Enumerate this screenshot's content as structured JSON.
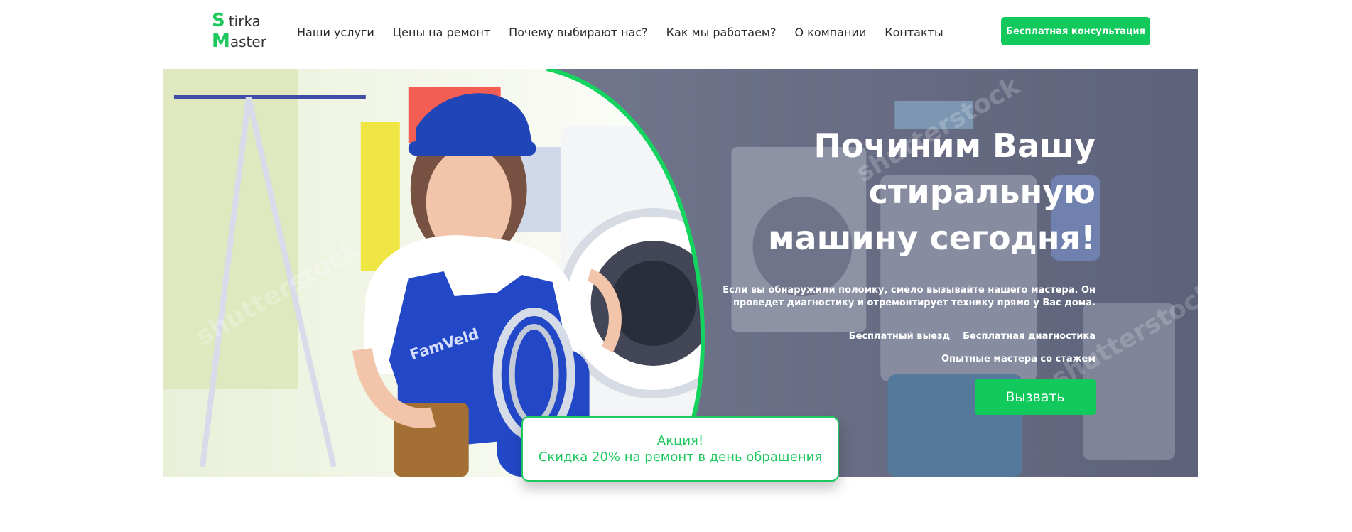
{
  "brand": {
    "logo_s": "S",
    "logo_tirka": "tirka",
    "logo_m": "M",
    "logo_aster": "aster",
    "accent_color": "#12c95c"
  },
  "nav": {
    "items": [
      {
        "label": "Наши услуги"
      },
      {
        "label": "Цены на ремонт"
      },
      {
        "label": "Почему выбирают нас?"
      },
      {
        "label": "Как мы работаем?"
      },
      {
        "label": "О компании"
      },
      {
        "label": "Контакты"
      }
    ],
    "cta_label": "Бесплатная консультация"
  },
  "hero": {
    "title_line1": "Починим Вашу",
    "title_line2": "стиральную",
    "title_line3": "машину сегодня!",
    "description_line1": "Если вы обнаружили поломку, смело вызывайте нашего мастера. Он",
    "description_line2": "проведет диагностику и отремонтирует технику прямо у Вас дома.",
    "features": [
      "Бесплатный выезд",
      "Бесплатная диагностика",
      "Опытные мастера со стажем"
    ],
    "call_label": "Вызвать",
    "image_watermark": "shutterstock",
    "uniform_text": "FamVeld",
    "overlay_color": "#5b607a"
  },
  "promo": {
    "title": "Акция!",
    "text": "Скидка 20% на ремонт в день обращения"
  }
}
